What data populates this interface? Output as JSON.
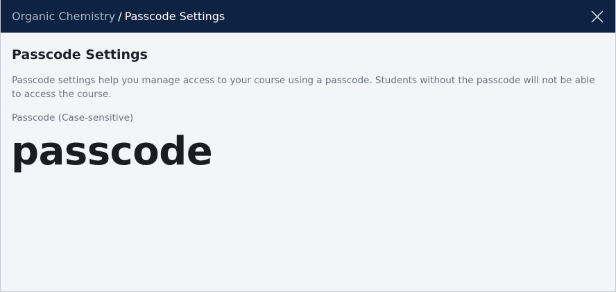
{
  "header": {
    "breadcrumb_parent": "Organic Chemistry",
    "breadcrumb_separator": "/",
    "breadcrumb_current": "Passcode Settings",
    "close_icon": "close-icon"
  },
  "main": {
    "title": "Passcode Settings",
    "description": "Passcode settings help you manage access to your course using a passcode. Students without the passcode will not be able to access the course.",
    "passcode_label": "Passcode (Case-sensitive)",
    "passcode_value": "passcode"
  },
  "colors": {
    "header_bg": "#0e2241",
    "body_bg": "#f3f5f9",
    "muted_text": "#6b7079",
    "strong_text": "#1a1c21"
  }
}
